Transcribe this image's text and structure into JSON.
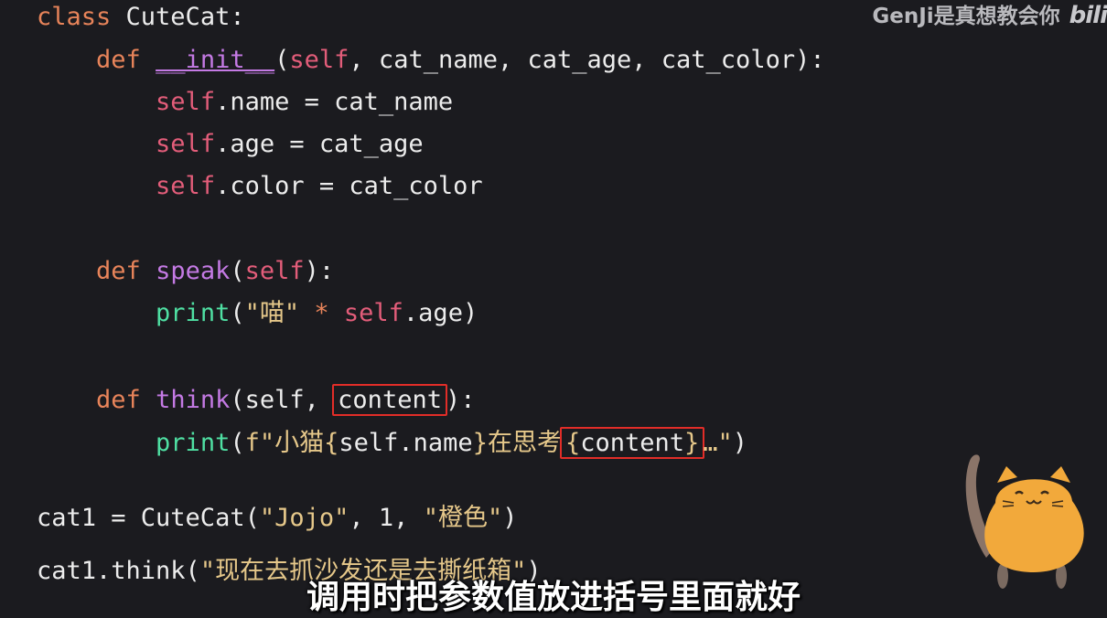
{
  "watermark": {
    "text": "GenJi是真想教会你",
    "logo": "bili"
  },
  "code": {
    "l1": {
      "kw": "class",
      "name": " CuteCat:"
    },
    "l2": {
      "indent": "    ",
      "kw": "def",
      "sp": " ",
      "name": "__init__",
      "open": "(",
      "self": "self",
      "rest": ", cat_name, cat_age, cat_color):"
    },
    "l3": {
      "indent": "        ",
      "self": "self",
      "rest": ".name = cat_name"
    },
    "l4": {
      "indent": "        ",
      "self": "self",
      "rest": ".age = cat_age"
    },
    "l5": {
      "indent": "        ",
      "self": "self",
      "rest": ".color = cat_color"
    },
    "l6": {
      "indent": "    ",
      "kw": "def",
      "sp": " ",
      "name": "speak",
      "open": "(",
      "self": "self",
      "rest": "):"
    },
    "l7": {
      "indent": "        ",
      "bi": "print",
      "open": "(",
      "str": "\"喵\"",
      "op": " * ",
      "self": "self",
      "rest": ".age)"
    },
    "l8": {
      "indent": "    ",
      "kw": "def",
      "sp": " ",
      "name": "think",
      "open": "(",
      "self": "self",
      "mid": ", ",
      "boxed": "content",
      "rest": "):"
    },
    "l9": {
      "indent": "        ",
      "bi": "print",
      "open": "(",
      "str1": "f\"小猫",
      "b1": "{",
      "expr1": "self.name",
      "b2": "}",
      "str2": "在思考",
      "b3": "{",
      "boxed": "content",
      "b4": "}",
      "str3": "…\"",
      "rest": ")"
    },
    "l10": {
      "pre": "cat1 = CuteCat(",
      "s1": "\"Jojo\"",
      "mid": ", ",
      "num": "1",
      "mid2": ", ",
      "s2": "\"橙色\"",
      "rest": ")"
    },
    "l11": {
      "pre": "cat1.think(",
      "s1": "\"现在去抓沙发还是去撕纸箱\"",
      "rest": ")"
    }
  },
  "subtitle": "调用时把参数值放进括号里面就好",
  "mascot": {
    "icon": "orange-cat-mascot",
    "color": "#f2a93b"
  }
}
